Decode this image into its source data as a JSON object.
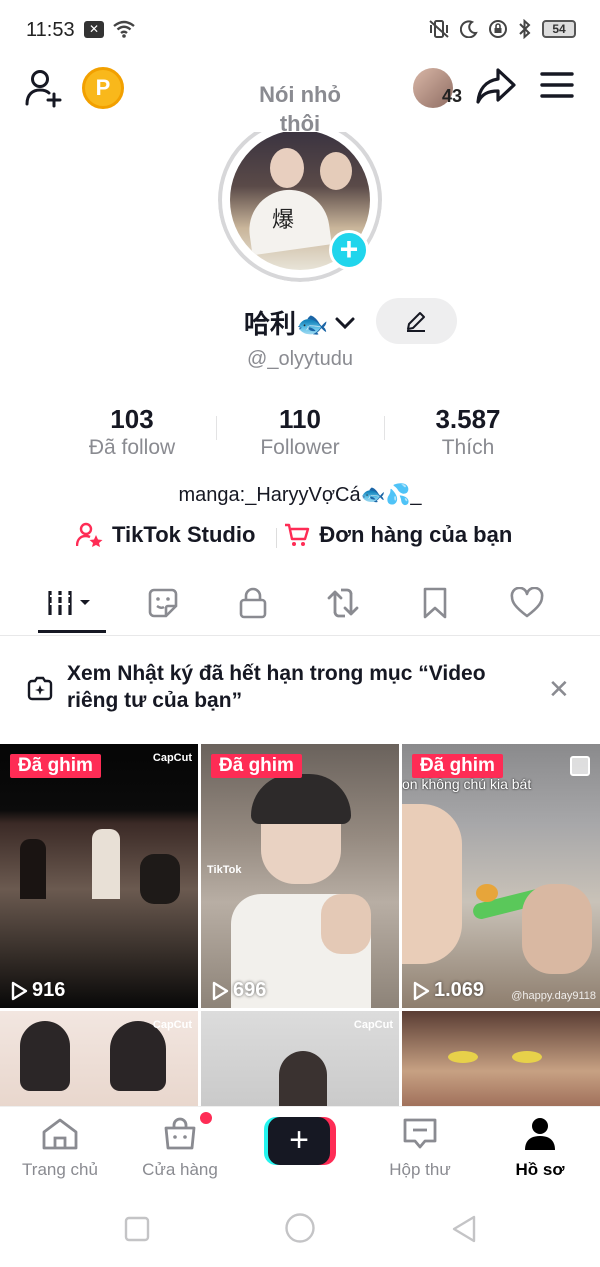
{
  "status_bar": {
    "time": "11:53",
    "battery": "54",
    "icons": [
      "notification-x-icon",
      "wifi-icon",
      "vibrate-icon",
      "moon-icon",
      "lock-rotation-icon",
      "bluetooth-icon"
    ]
  },
  "header": {
    "coin_label": "P",
    "note": "Nói nhỏ thôi",
    "friends_count": "43"
  },
  "profile": {
    "name": "哈利🐟",
    "handle": "@_olyytudu",
    "bio": "manga:_HaryyVợCá🐟💦_"
  },
  "stats": [
    {
      "value": "103",
      "label": "Đã follow"
    },
    {
      "value": "110",
      "label": "Follower"
    },
    {
      "value": "3.587",
      "label": "Thích"
    }
  ],
  "links": {
    "studio": "TikTok Studio",
    "orders": "Đơn hàng của bạn"
  },
  "notice": {
    "text": "Xem Nhật ký đã hết hạn trong mục “Video riêng tư của bạn”"
  },
  "grid": {
    "pin_label": "Đã ghim",
    "capcut_label": "CapCut",
    "tiles": [
      {
        "views": "916"
      },
      {
        "views": "696",
        "watermark": "TikTok"
      },
      {
        "views": "1.069",
        "caption": "on không chú kia bát",
        "watermark": "@happy.day9118"
      }
    ]
  },
  "bottom_nav": {
    "home": "Trang chủ",
    "shop": "Cửa hàng",
    "inbox": "Hộp thư",
    "profile": "Hồ sơ"
  },
  "colors": {
    "accent_red": "#fe2c55",
    "accent_cyan": "#20d5ec",
    "coin": "#f9b81b",
    "text_primary": "#161823",
    "text_secondary": "#8a8b91"
  }
}
